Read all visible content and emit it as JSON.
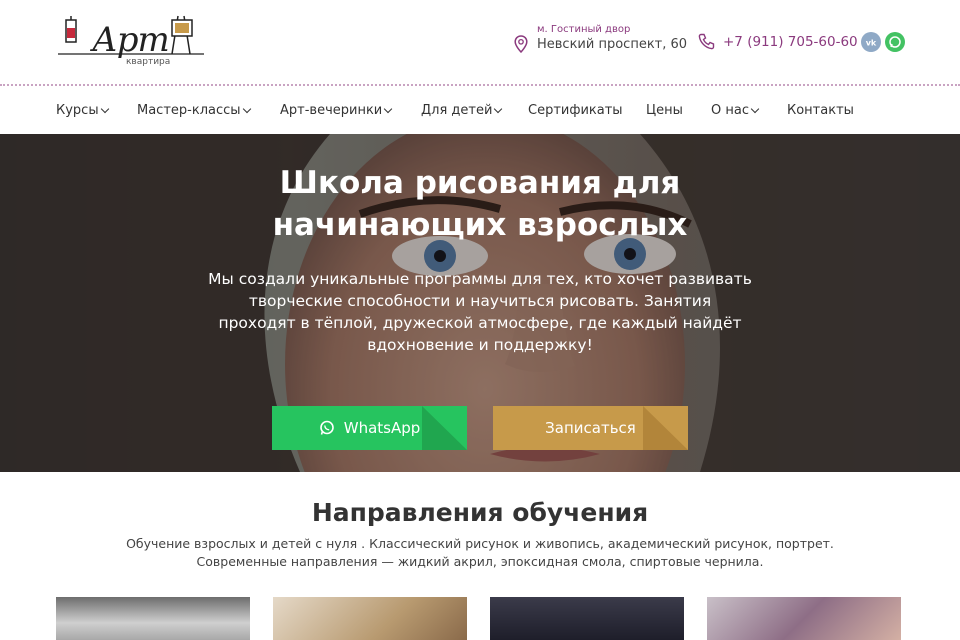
{
  "header": {
    "logo": {
      "word": "Арт",
      "sub": "квартира"
    },
    "address": {
      "metro": "м. Гостиный двор",
      "street": "Невский проспект, 60",
      "icon": "map-pin-icon"
    },
    "phone": {
      "number": "+7 (911) 705-60-60",
      "icon": "phone-icon"
    },
    "social": [
      {
        "name": "vk-icon",
        "color": "#8fa9c6"
      },
      {
        "name": "whatsapp-icon",
        "color": "#43c263"
      }
    ],
    "accent_color": "#8b3a7e"
  },
  "nav": {
    "items": [
      {
        "label": "Курсы",
        "dropdown": true
      },
      {
        "label": "Мастер-классы",
        "dropdown": true
      },
      {
        "label": "Арт-вечеринки",
        "dropdown": true
      },
      {
        "label": "Для детей",
        "dropdown": true
      },
      {
        "label": "Сертификаты",
        "dropdown": false
      },
      {
        "label": "Цены",
        "dropdown": false
      },
      {
        "label": "О нас",
        "dropdown": true
      },
      {
        "label": "Контакты",
        "dropdown": false
      }
    ]
  },
  "hero": {
    "title_line1": "Школа рисования для",
    "title_line2": "начинающих взрослых",
    "text": "Мы создали уникальные программы для тех, кто хочет развивать творческие способности и научиться рисовать. Занятия проходят в тёплой, дружеской атмосфере, где каждый найдёт вдохновение и поддержку!",
    "whatsapp_button": "WhatsApp",
    "signup_button": "Записаться",
    "whatsapp_color": "#26c45f",
    "signup_color": "#c79a4a"
  },
  "directions": {
    "title": "Направления обучения",
    "description": "Обучение взрослых и детей с нуля . Классический рисунок и живопись, академический рисунок, портрет. Современные направления — жидкий акрил, эпоксидная смола, спиртовые чернила."
  }
}
